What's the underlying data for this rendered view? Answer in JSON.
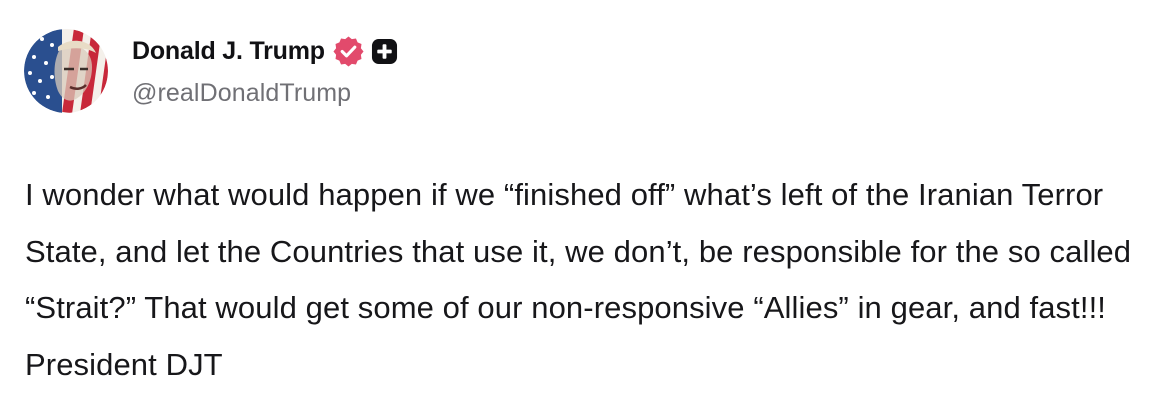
{
  "post": {
    "author": {
      "display_name": "Donald J. Trump",
      "handle": "@realDonaldTrump",
      "avatar_icon": "flag-portrait-avatar",
      "verified_icon": "verified-badge-icon",
      "badge_icon": "plus-badge-icon"
    },
    "text": "I wonder what would happen if we “finished off” what’s left of the Iranian Terror State, and let the Countries that use it, we don’t, be responsible for the so called “Strait?” That would get some of our non-responsive “Allies” in gear, and fast!!! President DJT"
  },
  "colors": {
    "verified_badge": "#e24a6c",
    "plus_badge": "#111114",
    "handle_text": "#707075",
    "body_text": "#17171a"
  }
}
